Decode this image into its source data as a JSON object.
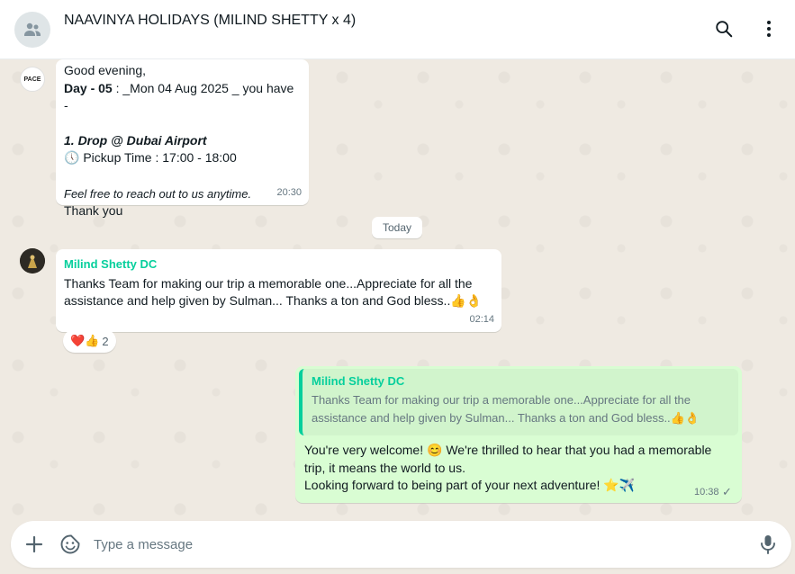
{
  "header": {
    "title": "NAAVINYA HOLIDAYS (MILIND SHETTY x 4)",
    "search_icon": "search-icon",
    "menu_icon": "more-vertical-icon"
  },
  "messages": [
    {
      "sender_avatar_text": "PACE",
      "line1": "Good evening,",
      "day_label": "Day - 05",
      "day_rest": " : _Mon 04 Aug 2025 _ you have -",
      "drop_heading": "1. Drop @ Dubai Airport",
      "pickup_icon": "🕔",
      "pickup": "Pickup Time : 17:00 - 18:00",
      "reach_out": "Feel free to reach out to us anytime.",
      "thanks": "Thank you",
      "time": "20:30"
    },
    {
      "sender": "Milind Shetty DC",
      "text_line1": "Thanks Team for making our trip a memorable one...Appreciate for all the",
      "text_line2": "assistance and help given by Sulman... Thanks a ton and God bless..👍👌",
      "time": "02:14",
      "reactions": {
        "emojis": "❤️👍",
        "count": "2"
      }
    },
    {
      "quoted_sender": "Milind Shetty DC",
      "quoted_line1": "Thanks Team for making our trip a memorable one...Appreciate for all the",
      "quoted_line2": "assistance and help given by Sulman... Thanks a ton and God bless..👍👌",
      "reply_line1": "You're very welcome! 😊 We're thrilled to hear that you had a memorable",
      "reply_line2": "trip, it means the world to us.",
      "reply_line3": "Looking forward to being part of your next adventure! ⭐✈️",
      "time": "10:38",
      "status": "✓"
    }
  ],
  "day_separator": "Today",
  "composer": {
    "placeholder": "Type a message",
    "value": ""
  },
  "colors": {
    "accent": "#06cf9c",
    "outgoing_bubble": "#d9fdd3",
    "wallpaper": "#efeae2"
  }
}
